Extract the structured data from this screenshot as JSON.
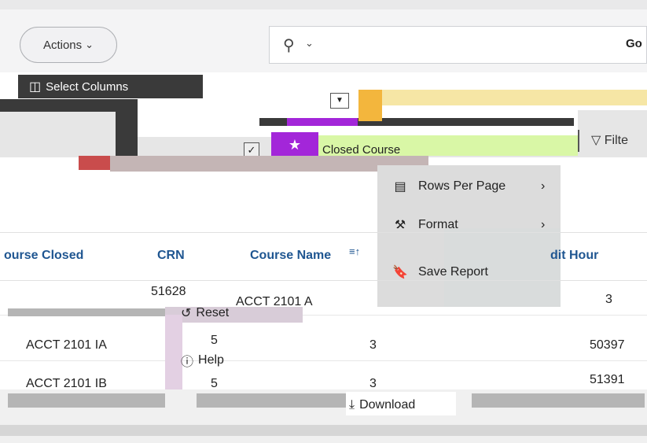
{
  "toolbar": {
    "actions_label": "Actions",
    "go_label": "Go"
  },
  "actions_menu": {
    "select_columns_label": "Select Columns",
    "closed_course_label": "Closed Course",
    "filter_label": "Filte",
    "rows_per_page_label": "Rows Per Page",
    "format_label": "Format",
    "save_report_label": "Save Report",
    "reset_label": "Reset",
    "help_label": "Help",
    "download_label": "Download"
  },
  "table": {
    "headers": [
      "ourse Closed",
      "CRN",
      "Course Name",
      "dit Hour"
    ],
    "rows": [
      {
        "course": "",
        "crn": "51628",
        "name": "ACCT 2101 A",
        "credit": "3"
      },
      {
        "course": "ACCT 2101 IA",
        "crn": "5",
        "name": "3",
        "credit": "50397"
      },
      {
        "course": "ACCT 2101 IB",
        "crn": "5",
        "name": "3",
        "credit": "51391"
      }
    ]
  }
}
